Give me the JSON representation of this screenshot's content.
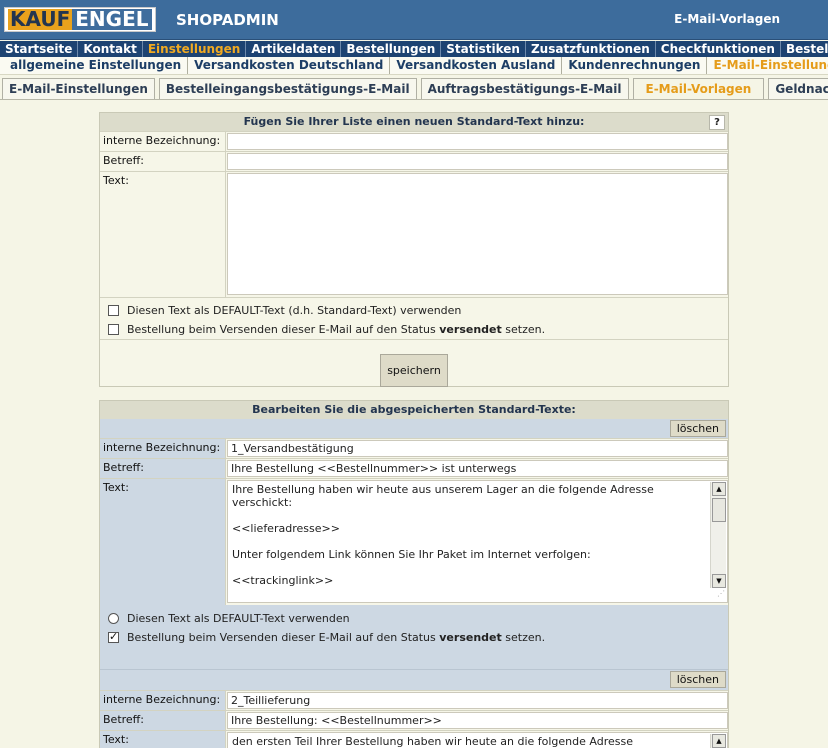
{
  "header": {
    "logo_part1": "KAUF",
    "logo_part2": "ENGEL",
    "app_title": "SHOPADMIN",
    "page_name": "E-Mail-Vorlagen"
  },
  "main_nav": [
    {
      "label": "Startseite"
    },
    {
      "label": "Kontakt"
    },
    {
      "label": "Einstellungen",
      "active": true
    },
    {
      "label": "Artikeldaten"
    },
    {
      "label": "Bestellungen"
    },
    {
      "label": "Statistiken"
    },
    {
      "label": "Zusatzfunktionen"
    },
    {
      "label": "Checkfunktionen"
    },
    {
      "label": "Bestellsc"
    }
  ],
  "sub_nav": [
    {
      "label": "allgemeine Einstellungen"
    },
    {
      "label": "Versandkosten Deutschland"
    },
    {
      "label": "Versandkosten Ausland"
    },
    {
      "label": "Kundenrechnungen"
    },
    {
      "label": "E-Mail-Einstellungen",
      "active": true
    }
  ],
  "tabs": [
    {
      "label": "E-Mail-Einstellungen"
    },
    {
      "label": "Bestelleingangsbestätigungs-E-Mail"
    },
    {
      "label": "Auftragsbestätigungs-E-Mail"
    },
    {
      "label": "E-Mail-Vorlagen",
      "active": true
    },
    {
      "label": "Geldnachfragen"
    }
  ],
  "new_form": {
    "title": "Fügen Sie Ihrer Liste einen neuen Standard-Text hinzu:",
    "help": "?",
    "label_internal": "interne Bezeichnung:",
    "label_subject": "Betreff:",
    "label_text": "Text:",
    "internal_value": "",
    "subject_value": "",
    "text_value": "",
    "check_default_label": "Diesen Text als DEFAULT-Text (d.h. Standard-Text) verwenden",
    "check_status_prefix": "Bestellung beim Versenden dieser E-Mail auf den Status ",
    "check_status_bold": "versendet",
    "check_status_suffix": " setzen.",
    "save_label": "speichern"
  },
  "edit_section": {
    "title": "Bearbeiten Sie die abgespeicherten Standard-Texte:",
    "delete_label": "löschen",
    "label_internal": "interne Bezeichnung:",
    "label_subject": "Betreff:",
    "label_text": "Text:",
    "radio_default_label": "Diesen Text als DEFAULT-Text verwenden",
    "check_status_prefix": "Bestellung beim Versenden dieser E-Mail auf den Status ",
    "check_status_bold": "versendet",
    "check_status_suffix": " setzen.",
    "entries": [
      {
        "internal": "1_Versandbestätigung",
        "subject": "Ihre Bestellung <<Bestellnummer>> ist unterwegs",
        "text_lines": [
          "Ihre Bestellung haben wir heute aus unserem Lager an die folgende Adresse",
          "verschickt:",
          "",
          "<<lieferadresse>>",
          "",
          "Unter folgendem Link können Sie Ihr Paket im Internet verfolgen:",
          "",
          "<<trackinglink>>"
        ],
        "status_checked": true,
        "default_checked": false
      },
      {
        "internal": "2_Teillieferung",
        "subject": "Ihre Bestellung: <<Bestellnummer>>",
        "text_lines": [
          "den ersten Teil Ihrer Bestellung haben wir heute an die folgende Adresse"
        ]
      }
    ]
  },
  "colors": {
    "header_bg": "#3d6c9c",
    "nav_bg": "#1d4372",
    "accent": "#e59c1a",
    "page_bg": "#f5f5e6",
    "edit_zone_bg": "#cdd8e3"
  }
}
